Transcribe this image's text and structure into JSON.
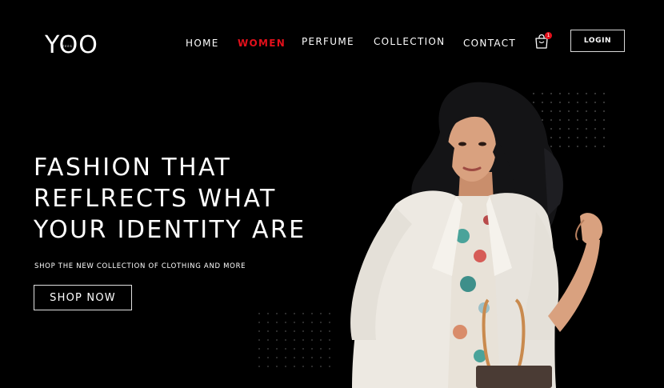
{
  "brand": {
    "logo_text": "YOO",
    "logo_small": "TEES"
  },
  "nav": {
    "items": [
      {
        "label": "HOME"
      },
      {
        "label": "WOMEN"
      },
      {
        "label": "PERFUME"
      },
      {
        "label": "COLLECTION"
      },
      {
        "label": "CONTACT"
      }
    ],
    "active": "WOMEN",
    "active_color": "#e3101b"
  },
  "cart": {
    "count": "1",
    "icon": "shopping-bag-icon"
  },
  "login": {
    "label": "LOGIN"
  },
  "hero": {
    "title_lines": [
      "FASHION THAT",
      "REFLRECTS WHAT",
      "YOUR IDENTITY ARE"
    ],
    "subtitle": "SHOP THE NEW COLLECTION OF CLOTHING AND MORE",
    "cta_label": "SHOP NOW"
  },
  "colors": {
    "background": "#000000",
    "text": "#ffffff",
    "accent": "#e3101b"
  }
}
